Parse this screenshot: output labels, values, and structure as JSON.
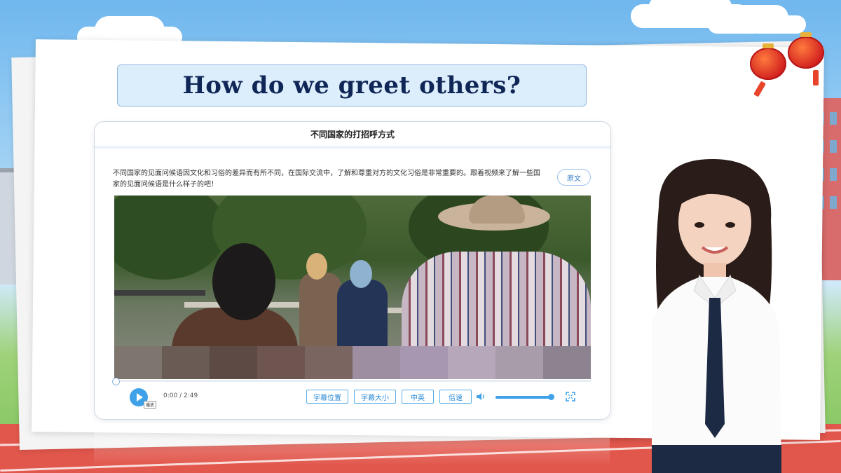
{
  "slide": {
    "title": "How do we greet others?"
  },
  "card": {
    "header_title": "不同国家的打招呼方式",
    "description": "不同国家的见面问候语因文化和习俗的差异而有所不同，在国际交流中，了解和尊重对方的文化习俗是非常重要的。跟着视频来了解一些国家的见面问候语是什么样子的吧！",
    "original_text_button": "原文"
  },
  "player": {
    "play_icon": "play-icon",
    "play_tooltip": "播放",
    "current_time": "0:00",
    "duration": "2:49",
    "time_display": "0:00 / 2:49",
    "progress": 0,
    "buttons": {
      "subtitle_position": "字幕位置",
      "subtitle_size": "字幕大小",
      "language": "中英",
      "speed": "倍速"
    },
    "volume_icon": "speaker-icon",
    "volume_level": 1.0,
    "fullscreen_icon": "fullscreen-icon"
  },
  "colors": {
    "title_text": "#0f2657",
    "title_bg": "#dceefb",
    "accent": "#3fa2e8"
  }
}
